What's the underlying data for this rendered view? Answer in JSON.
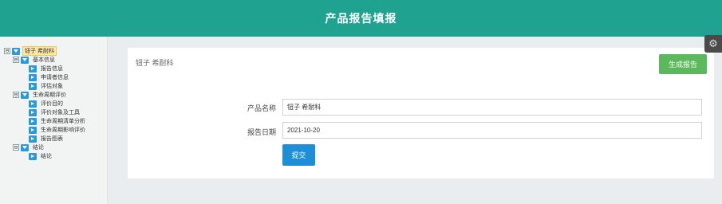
{
  "header": {
    "title": "产品报告填报"
  },
  "tree": {
    "root": {
      "label": "钮子 希耐科",
      "toggle": "⊟"
    },
    "groups": [
      {
        "label": "基本信息",
        "toggle": "⊟",
        "children": [
          "报告信息",
          "申请者信息",
          "评估对象"
        ]
      },
      {
        "label": "生命周期评价",
        "toggle": "⊟",
        "children": [
          "评价目的",
          "评价对象及工具",
          "生命周期清单分析",
          "生命周期影响评价",
          "报告图表"
        ]
      },
      {
        "label": "结论",
        "toggle": "⊟",
        "children": [
          "结论"
        ]
      }
    ]
  },
  "card": {
    "title": "钮子 希耐科",
    "generate_label": "生成报告",
    "product_name_label": "产品名称",
    "product_name_value": "钮子 希耐科",
    "report_date_label": "报告日期",
    "report_date_value": "2021-10-20",
    "submit_label": "提交"
  },
  "settings": {
    "icon": "settings-gear-icon",
    "glyph": "⚙"
  }
}
